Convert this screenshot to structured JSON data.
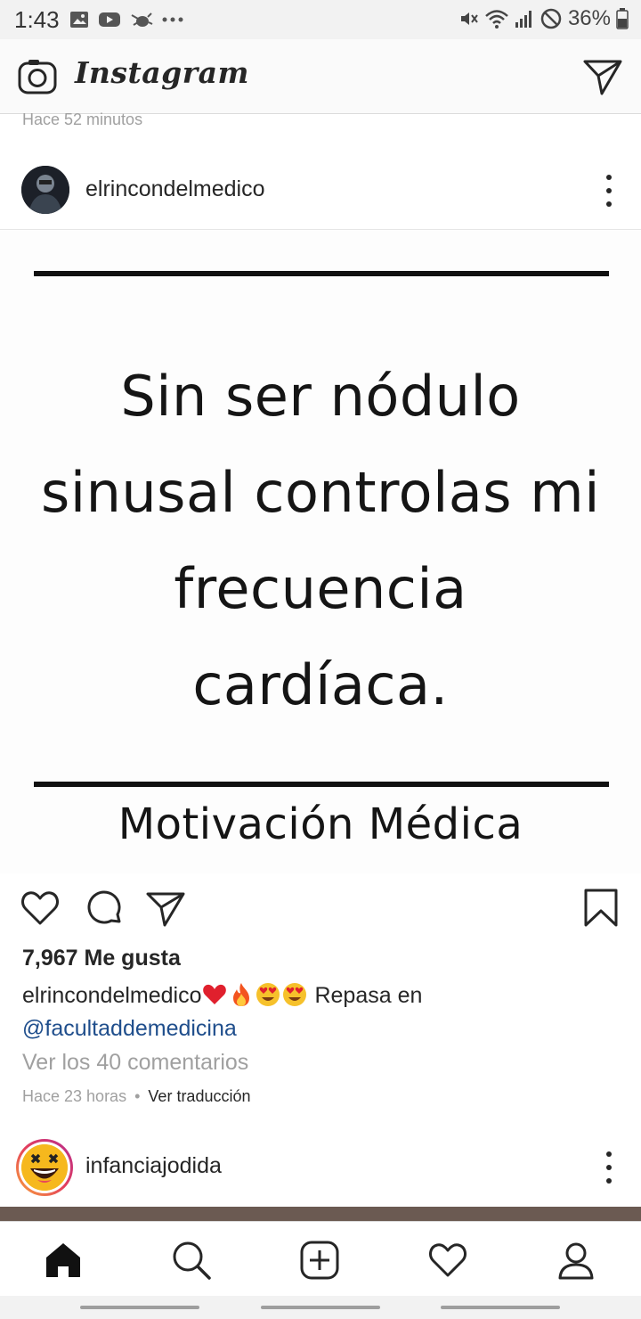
{
  "status_bar": {
    "time": "1:43",
    "battery": "36%",
    "icons": [
      "image-icon",
      "youtube-icon",
      "bug-icon",
      "more-notifications-icon",
      "mute-icon",
      "wifi-icon",
      "signal-icon",
      "do-not-disturb-icon",
      "battery-icon"
    ]
  },
  "header": {
    "brand": "Instagram",
    "camera_icon": "camera-icon",
    "direct_icon": "send-icon"
  },
  "previous_post": {
    "timestamp": "Hace 52 minutos"
  },
  "post": {
    "username": "elrincondelmedico",
    "image": {
      "quote_lines": [
        "Sin ser nódulo",
        "sinusal controlas mi",
        "frecuencia",
        "cardíaca."
      ],
      "signature": "Motivación Médica"
    },
    "likes": "7,967 Me gusta",
    "caption": {
      "username": "elrincondelmedico",
      "emojis": [
        "red-heart-emoji",
        "fire-emoji",
        "heart-eyes-emoji",
        "heart-eyes-emoji"
      ],
      "text": "Repasa en",
      "mention": "@facultaddemedicina"
    },
    "view_comments": "Ver los 40 comentarios",
    "timestamp": "Hace 23 horas",
    "separator": "•",
    "translate": "Ver traducción",
    "actions": [
      "heart-icon",
      "comment-icon",
      "share-icon",
      "bookmark-icon"
    ]
  },
  "next_post": {
    "username": "infanciajodida"
  },
  "bottom_nav": {
    "items": [
      "home-icon",
      "search-icon",
      "new-post-icon",
      "activity-icon",
      "profile-icon"
    ],
    "active": "home-icon"
  },
  "colors": {
    "text": "#262626",
    "muted": "#a0a0a0",
    "link": "#1f4e8c",
    "border": "#dbdbdb"
  }
}
